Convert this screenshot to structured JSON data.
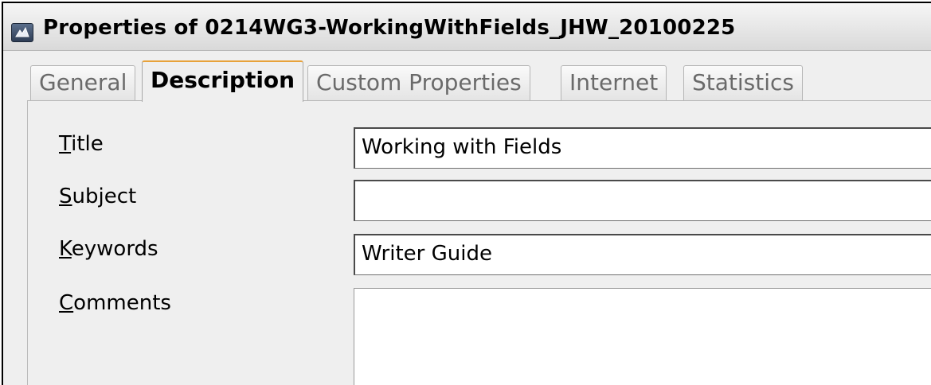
{
  "window": {
    "title": "Properties of 0214WG3-WorkingWithFields_JHW_20100225",
    "icon": "document-properties-icon"
  },
  "tabs": [
    {
      "label": "General",
      "active": false
    },
    {
      "label": "Description",
      "active": true
    },
    {
      "label": "Custom Properties",
      "active": false
    },
    {
      "label": "Internet",
      "active": false
    },
    {
      "label": "Statistics",
      "active": false
    }
  ],
  "form": {
    "title": {
      "mnemonic": "T",
      "rest": "itle",
      "value": "Working with Fields"
    },
    "subject": {
      "mnemonic": "S",
      "rest": "ubject",
      "value": ""
    },
    "keywords": {
      "mnemonic": "K",
      "rest": "eywords",
      "value": "Writer Guide"
    },
    "comments": {
      "mnemonic": "C",
      "rest": "omments",
      "value": ""
    }
  },
  "colors": {
    "active_tab_accent": "#e8a23a",
    "dialog_background": "#efefef"
  }
}
